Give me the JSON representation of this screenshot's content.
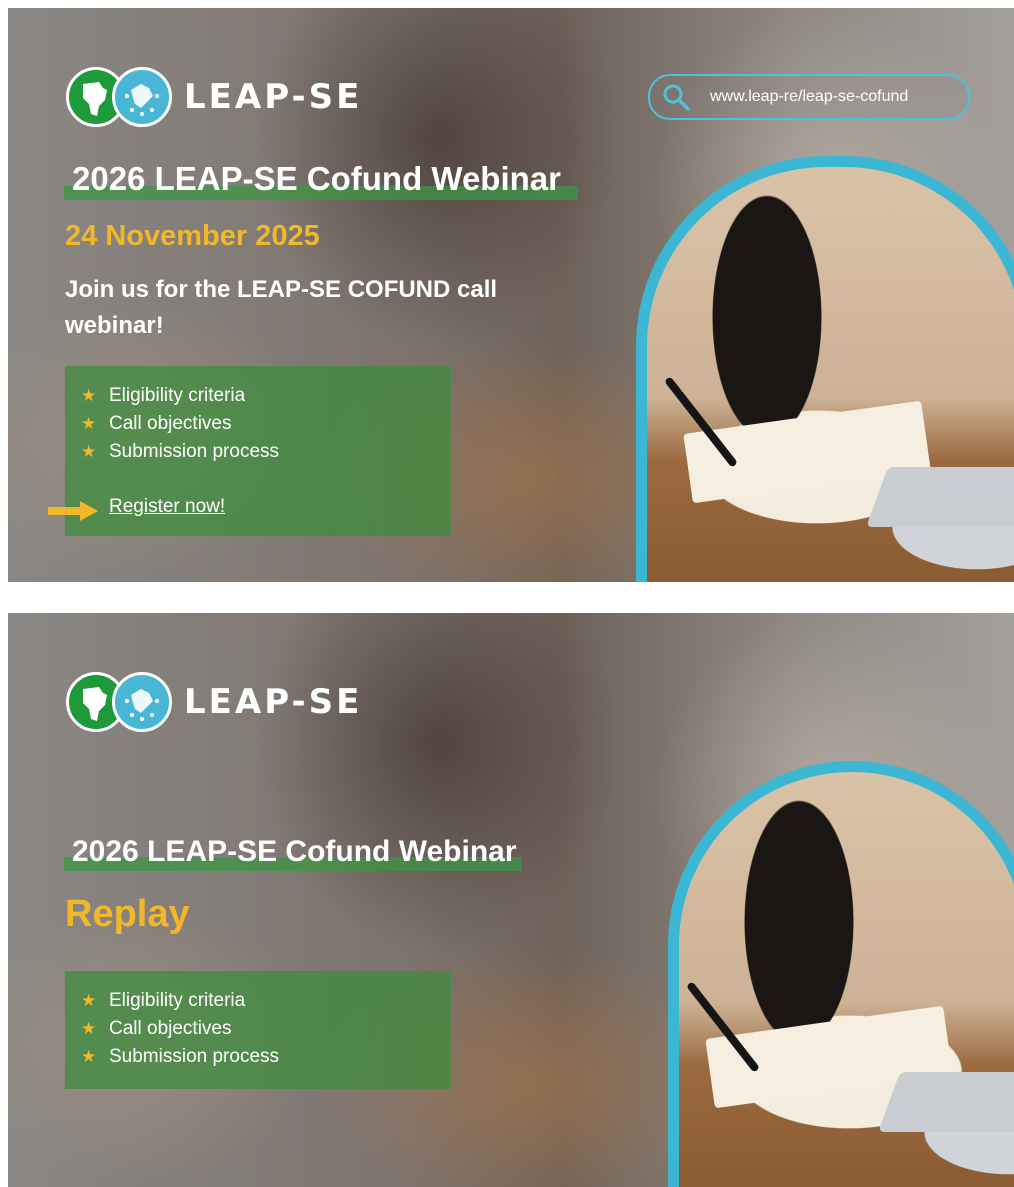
{
  "banner1": {
    "logo_text": "LEAP-SE",
    "website": "www.leap-re/leap-se-cofund",
    "title": "2026 LEAP-SE Cofund Webinar",
    "date": "24 November 2025",
    "subtitle": "Join us for the LEAP-SE COFUND call webinar!",
    "bullets": [
      "Eligibility criteria",
      "Call objectives",
      "Submission process"
    ],
    "register_label": "Register now!"
  },
  "banner2": {
    "logo_text": "LEAP-SE",
    "title": "2026 LEAP-SE Cofund Webinar",
    "replay": "Replay",
    "bullets": [
      "Eligibility criteria",
      "Call objectives",
      "Submission process"
    ]
  },
  "icons": {
    "search": "search-icon",
    "star": "star-icon",
    "arrow": "arrow-right-icon",
    "logo_africa": "africa-globe-icon",
    "logo_europe": "europe-stars-icon"
  },
  "colors": {
    "accent_yellow": "#f2b829",
    "accent_cyan": "#3cb7d3",
    "green_box": "#3c8c3c",
    "logo_green": "#1f9a3a",
    "logo_blue": "#49b6d6"
  }
}
